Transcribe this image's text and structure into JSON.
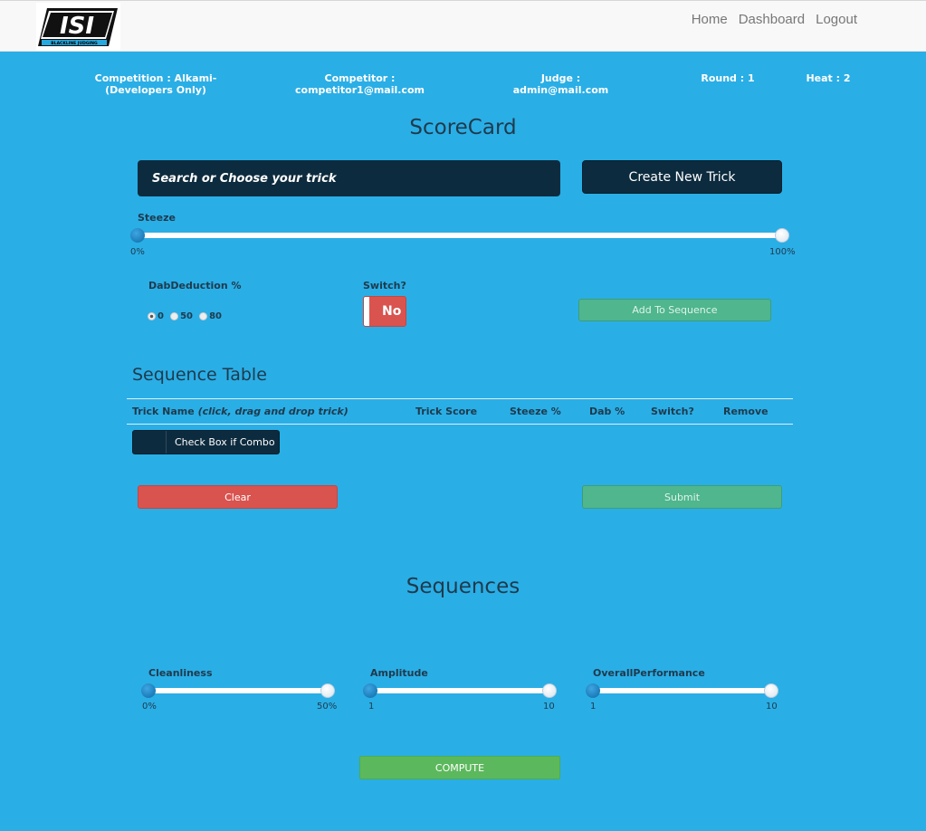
{
  "nav": {
    "logo_text": "ISI",
    "logo_sub": "BLACKLINE JUDGING",
    "links": [
      "Home",
      "Dashboard",
      "Logout"
    ]
  },
  "info": {
    "competition": "Competition : Alkami-(Developers Only)",
    "competitor": "Competitor : competitor1@mail.com",
    "judge": "Judge : admin@mail.com",
    "round": "Round : 1",
    "heat": "Heat : 2"
  },
  "scorecard": {
    "title": "ScoreCard",
    "search_placeholder": "Search or Choose your trick",
    "create_button": "Create New Trick",
    "steeze_label": "Steeze",
    "steeze_min": "0%",
    "steeze_max": "100%",
    "steeze_value_fraction": 0,
    "dab_label": "DabDeduction %",
    "dab_options": [
      "0",
      "50",
      "80"
    ],
    "dab_selected": "0",
    "switch_label": "Switch?",
    "switch_value": "No",
    "add_button": "Add To Sequence"
  },
  "sequence_table": {
    "title": "Sequence Table",
    "headers": {
      "trick_name": "Trick Name",
      "trick_name_hint": "(click, drag and drop trick)",
      "trick_score": "Trick Score",
      "steeze": "Steeze %",
      "dab": "Dab %",
      "switch": "Switch?",
      "remove": "Remove"
    },
    "combo_button": "Check Box if Combo",
    "clear_button": "Clear",
    "submit_button": "Submit"
  },
  "sequences": {
    "title": "Sequences",
    "sliders": [
      {
        "label": "Cleanliness",
        "min": "0%",
        "max": "50%",
        "value_fraction": 0
      },
      {
        "label": "Amplitude",
        "min": "1",
        "max": "10",
        "value_fraction": 0
      },
      {
        "label": "OverallPerformance",
        "min": "1",
        "max": "10",
        "value_fraction": 0
      }
    ],
    "compute_button": "COMPUTE"
  },
  "colors": {
    "background": "#2aaee6",
    "dark": "#0d2b3e",
    "danger": "#d9534f",
    "success": "#5cb85c"
  }
}
